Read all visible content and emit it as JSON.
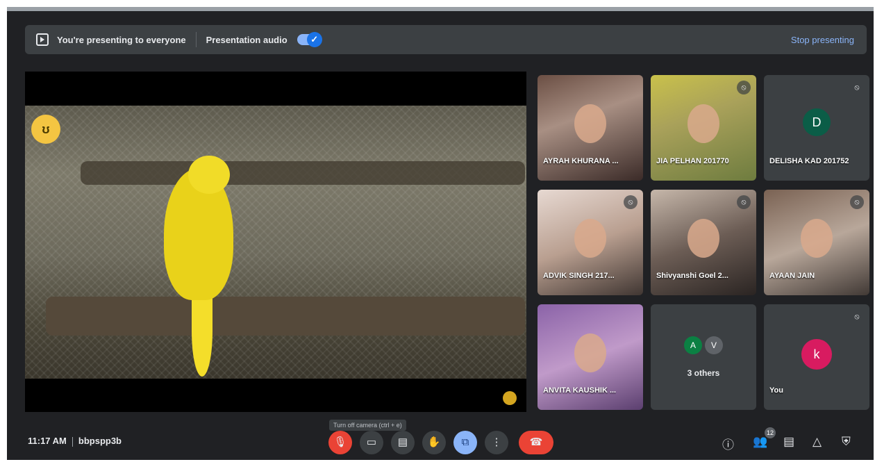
{
  "banner": {
    "presenting_text": "You're presenting to everyone",
    "audio_label": "Presentation audio",
    "stop_label": "Stop presenting"
  },
  "participants": [
    {
      "name": "AYRAH KHURANA ...",
      "style": "photo"
    },
    {
      "name": "JIA PELHAN 201770",
      "style": "photo"
    },
    {
      "name": "DELISHA KAD 201752",
      "initial": "D",
      "avatar_color": "#0b5d47"
    },
    {
      "name": "ADVIK SINGH 217...",
      "style": "photo"
    },
    {
      "name": "Shivyanshi Goel 2...",
      "style": "photo"
    },
    {
      "name": "AYAAN JAIN",
      "style": "photo"
    },
    {
      "name": "ANVITA KAUSHIK ...",
      "style": "photo"
    }
  ],
  "others": {
    "initials": [
      "A",
      "V"
    ],
    "label": "3 others"
  },
  "self": {
    "name": "You",
    "initial": "k",
    "avatar_color": "#d81b60"
  },
  "bottom": {
    "time": "11:17 AM",
    "meeting_code": "bbpspp3b",
    "tooltip": "Turn off camera (ctrl + e)",
    "people_count": "12"
  },
  "colors": {
    "accent": "#8ab4f8",
    "danger": "#ea4335",
    "background": "#202124"
  }
}
